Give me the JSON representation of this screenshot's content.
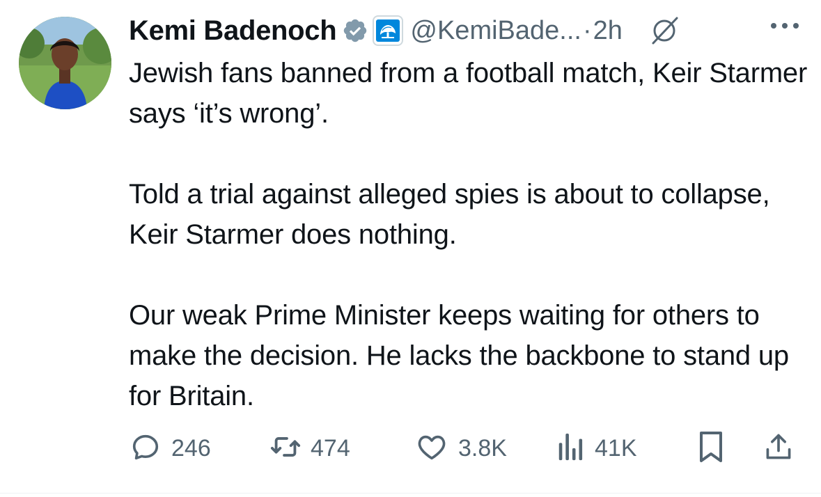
{
  "post": {
    "author_name": "Kemi Badenoch",
    "handle": "@KemiBade...",
    "separator": "·",
    "time": "2h",
    "paragraphs": [
      "Jewish fans banned from a football match, Keir Starmer says ‘it’s wrong’.",
      "Told a trial against alleged spies is about to collapse, Keir Starmer does nothing.",
      "Our weak Prime Minister keeps waiting for others to make the decision. He lacks the backbone to stand up for Britain."
    ]
  },
  "metrics": {
    "replies": "246",
    "reposts": "474",
    "likes": "3.8K",
    "views": "41K"
  },
  "icons": {
    "verified": "verified-badge-icon",
    "affiliation": "conservatives-tree-icon",
    "grok": "grok-icon",
    "more": "more-options-icon",
    "reply": "reply-icon",
    "repost": "repost-icon",
    "like": "heart-icon",
    "views": "views-chart-icon",
    "bookmark": "bookmark-icon",
    "share": "share-icon"
  },
  "colors": {
    "text": "#0f1419",
    "secondary": "#536471",
    "verified_badge": "#829aab",
    "affiliation_blue": "#0087dc"
  }
}
